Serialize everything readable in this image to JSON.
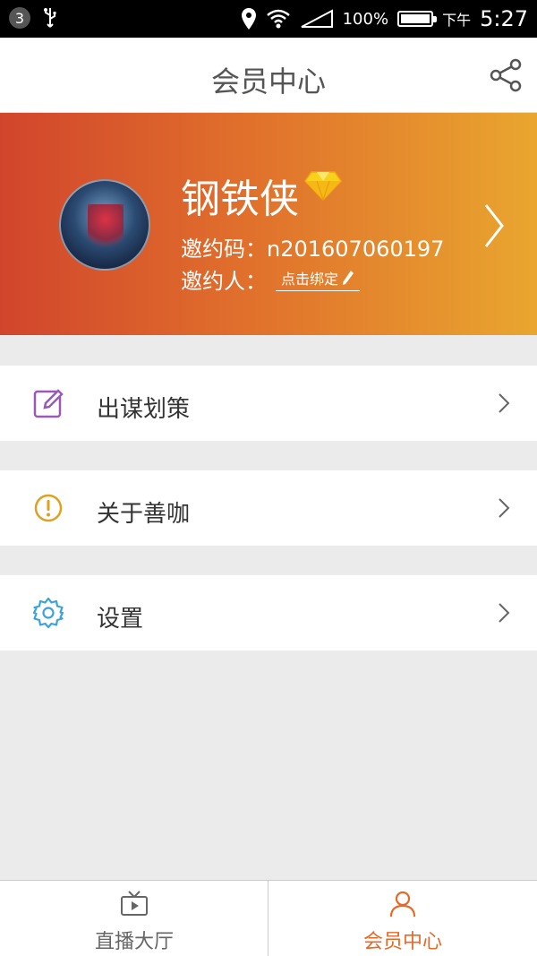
{
  "status_bar": {
    "notification_count": "3",
    "battery": "100%",
    "time_prefix": "下午",
    "time": "5:27"
  },
  "header": {
    "title": "会员中心",
    "share_icon": "share-icon"
  },
  "profile": {
    "username": "钢铁侠",
    "invite_code": "邀约码：n201607060197",
    "inviter_label": "邀约人：",
    "bind_link": "点击绑定",
    "vip_icon": "diamond-icon"
  },
  "menu": [
    {
      "label": "出谋划策",
      "icon": "edit-icon",
      "icon_color": "#9b59b6"
    },
    {
      "label": "关于善咖",
      "icon": "info-alert-icon",
      "icon_color": "#e0a020"
    },
    {
      "label": "设置",
      "icon": "gear-icon",
      "icon_color": "#3ba3d8"
    }
  ],
  "tabbar": {
    "tabs": [
      {
        "label": "直播大厅",
        "icon": "tv-icon",
        "active": false
      },
      {
        "label": "会员中心",
        "icon": "user-icon",
        "active": true
      }
    ],
    "active_color": "#e46a28",
    "inactive_color": "#666666"
  }
}
